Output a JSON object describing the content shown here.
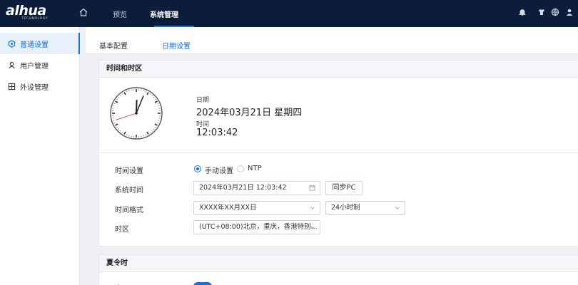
{
  "brand": {
    "name": "alhua",
    "tagline": "TECHNOLOGY"
  },
  "topnav": {
    "items": [
      {
        "label": "预览"
      },
      {
        "label": "系统管理"
      }
    ]
  },
  "sidebar": {
    "items": [
      {
        "label": "普通设置",
        "icon": "hexagon-settings-icon"
      },
      {
        "label": "用户管理",
        "icon": "user-icon"
      },
      {
        "label": "外设管理",
        "icon": "device-grid-icon"
      }
    ]
  },
  "tabs": [
    {
      "label": "基本配置"
    },
    {
      "label": "日期设置"
    }
  ],
  "time_panel": {
    "title": "时间和时区",
    "date_label": "日期",
    "date_value": "2024年03月21日 星期四",
    "time_label": "时间",
    "time_value": "12:03:42",
    "clock": {
      "hour": 12,
      "minute": 3,
      "second": 42
    }
  },
  "form": {
    "time_setting": {
      "label": "时间设置",
      "options": [
        "手动设置",
        "NTP"
      ],
      "selected": "手动设置"
    },
    "system_time": {
      "label": "系统时间",
      "value": "2024年03月21日 12:03:42",
      "sync_button": "同步PC"
    },
    "time_format": {
      "label": "时间格式",
      "date_format": "XXXX年XX月XX日",
      "hour_format": "24小时制"
    },
    "timezone": {
      "label": "时区",
      "value": "(UTC+08:00)北京，重庆，香港特别..."
    }
  },
  "dst_panel": {
    "title": "夏令时",
    "enable_label": "启用",
    "enabled": true
  },
  "colors": {
    "topbar": "#0b1d3a",
    "accent": "#1a6fd6"
  }
}
